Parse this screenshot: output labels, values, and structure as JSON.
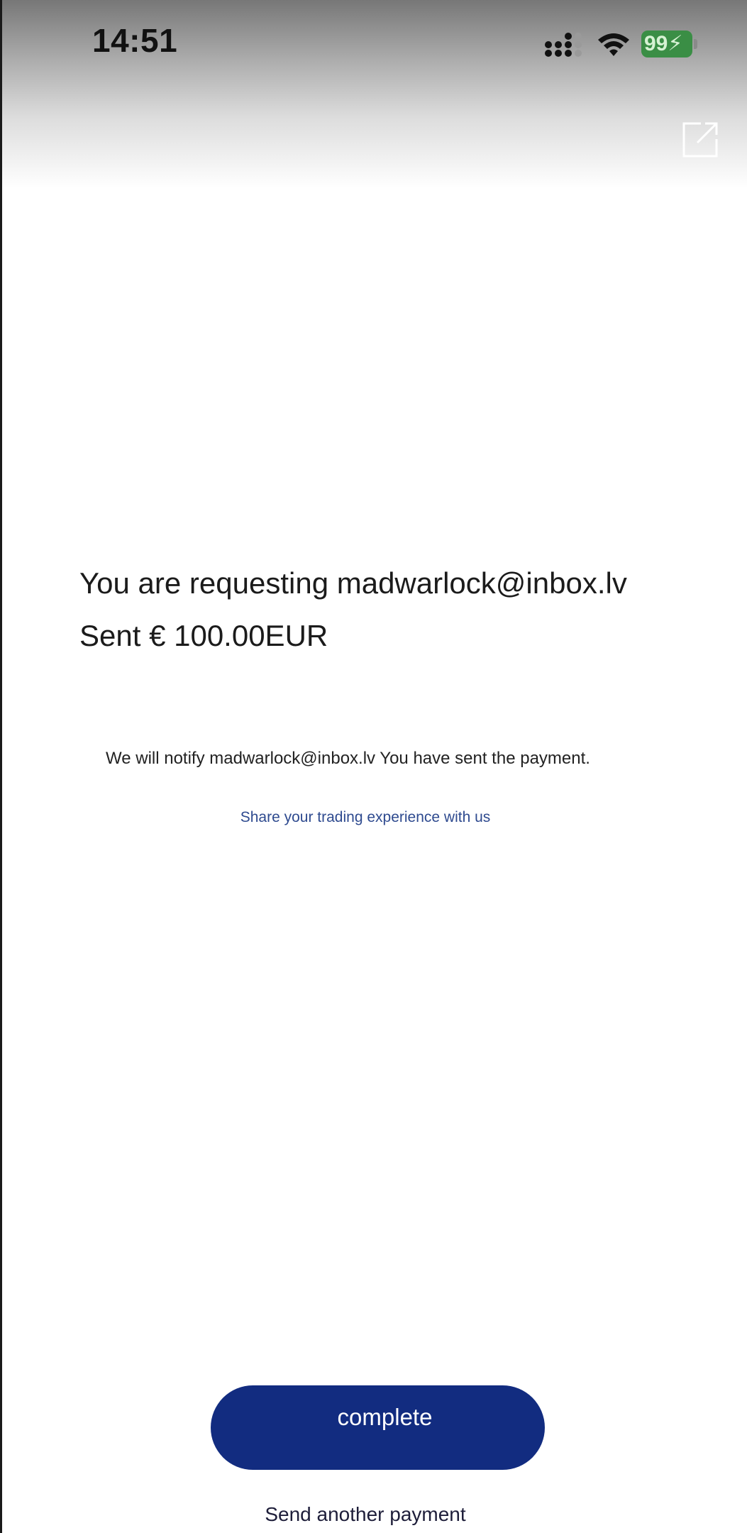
{
  "status_bar": {
    "time": "14:51",
    "battery_level": "99",
    "signal_icon": "cellular-signal-icon",
    "wifi_icon": "wifi-icon",
    "battery_color": "#3a8e45"
  },
  "header": {
    "share_icon": "external-share-icon"
  },
  "main": {
    "request_line": "You are requesting madwarlock@inbox.lv",
    "amount_line": "Sent € 100.00EUR",
    "notify_text": "We will notify madwarlock@inbox.lv You have sent the payment.",
    "share_link": "Share your trading experience with us"
  },
  "actions": {
    "complete_label": "complete",
    "send_another_label": "Send another payment",
    "accent_color": "#122c80"
  }
}
